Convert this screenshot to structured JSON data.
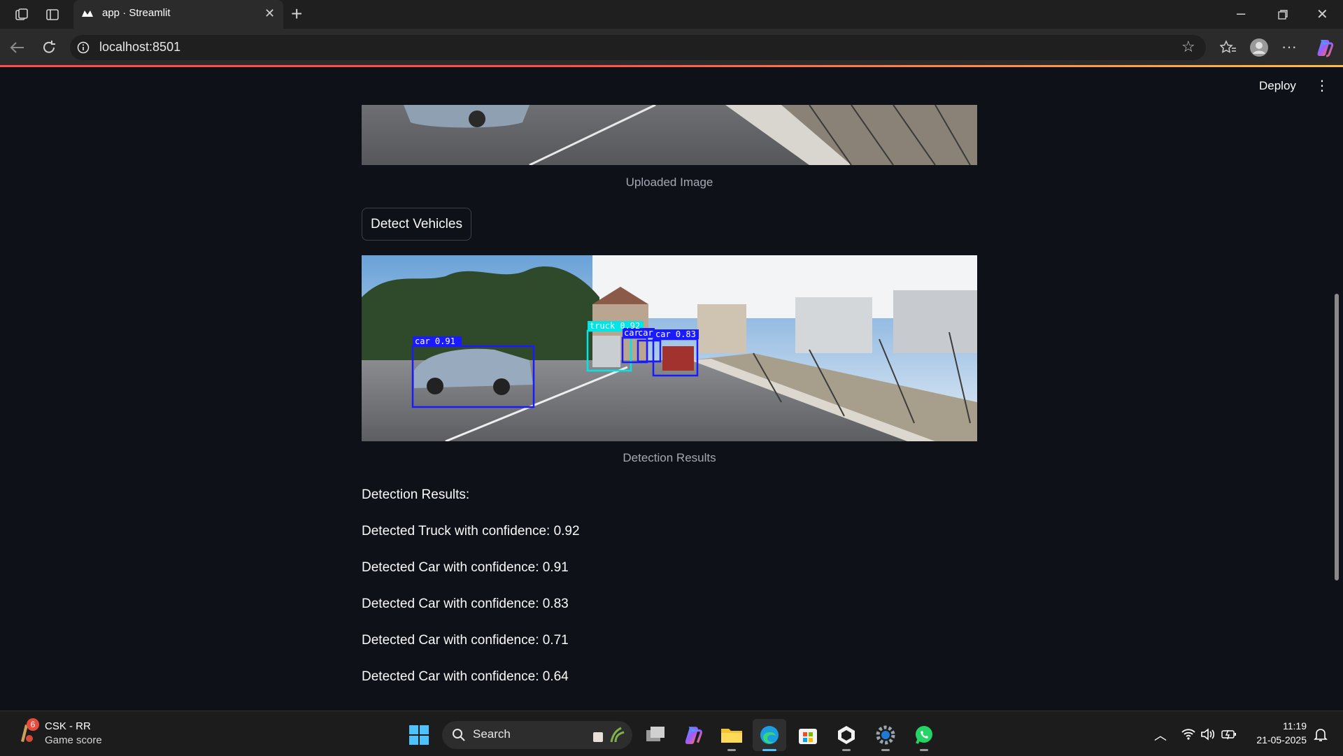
{
  "browser": {
    "tab_title": "app · Streamlit",
    "url": "localhost:8501"
  },
  "app": {
    "deploy_label": "Deploy",
    "uploaded_caption": "Uploaded Image",
    "detect_button": "Detect Vehicles",
    "results_caption": "Detection Results",
    "results_header": "Detection Results:",
    "results": [
      "Detected Truck with confidence: 0.92",
      "Detected Car with confidence: 0.91",
      "Detected Car with confidence: 0.83",
      "Detected Car with confidence: 0.71",
      "Detected Car with confidence: 0.64"
    ],
    "boxes": [
      {
        "label": "car 0.91",
        "color": "#1a1aff"
      },
      {
        "label": "truck 0.92",
        "color": "#00e5e5"
      },
      {
        "label": "car",
        "color": "#1a1aff"
      },
      {
        "label": "car",
        "color": "#1a1aff"
      },
      {
        "label": "car 0.83",
        "color": "#1a1aff"
      }
    ]
  },
  "taskbar": {
    "widget_title": "CSK - RR",
    "widget_subtitle": "Game score",
    "widget_badge": "6",
    "search_label": "Search",
    "time": "11:19",
    "date": "21-05-2025"
  },
  "colors": {
    "app_background": "#0e1117",
    "accent_red": "#ff4b4b",
    "box_blue": "#1a1aff",
    "box_cyan": "#00e5e5"
  },
  "icons": [
    "workspaces-icon",
    "tab-actions-icon",
    "streamlit-favicon",
    "close-icon",
    "new-tab-icon",
    "minimize-icon",
    "restore-icon",
    "window-close-icon",
    "back-icon",
    "refresh-icon",
    "info-icon",
    "favorite-star-icon",
    "favorites-icon",
    "profile-icon",
    "more-icon",
    "copilot-icon",
    "kebab-menu-icon",
    "windows-start-icon",
    "search-icon",
    "task-view-icon",
    "copilot-app-icon",
    "file-explorer-icon",
    "edge-icon",
    "store-icon",
    "terminal-icon",
    "settings-icon",
    "whatsapp-icon",
    "chevron-up-icon",
    "wifi-icon",
    "volume-icon",
    "battery-icon",
    "notification-icon"
  ]
}
